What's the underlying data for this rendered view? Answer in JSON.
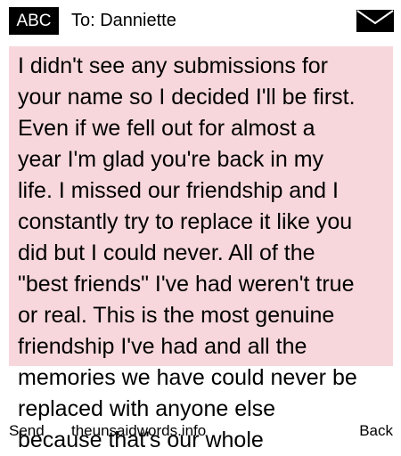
{
  "header": {
    "input_mode": "ABC",
    "recipient": "To: Danniette",
    "icon": "mail-icon"
  },
  "message": {
    "text": "I didn't see any submissions for\nyour name so I decided I'll be first.\nEven if we fell out for almost a\nyear I'm glad you're back in my\nlife. I missed our friendship and I\nconstantly try to replace it like you\ndid but I could never. All of the\n\"best friends\" I've had weren't true\nor real. This is the most genuine\nfriendship I've had and all the\nmemories we have could never be\nreplaced with anyone else\nbecause that's our whole"
  },
  "softkeys": {
    "left": "Send",
    "center": "theunsaidwords.info",
    "right": "Back"
  },
  "colors": {
    "message_background": "#f7d7dc",
    "header_badge": "#000000",
    "text": "#000000"
  }
}
